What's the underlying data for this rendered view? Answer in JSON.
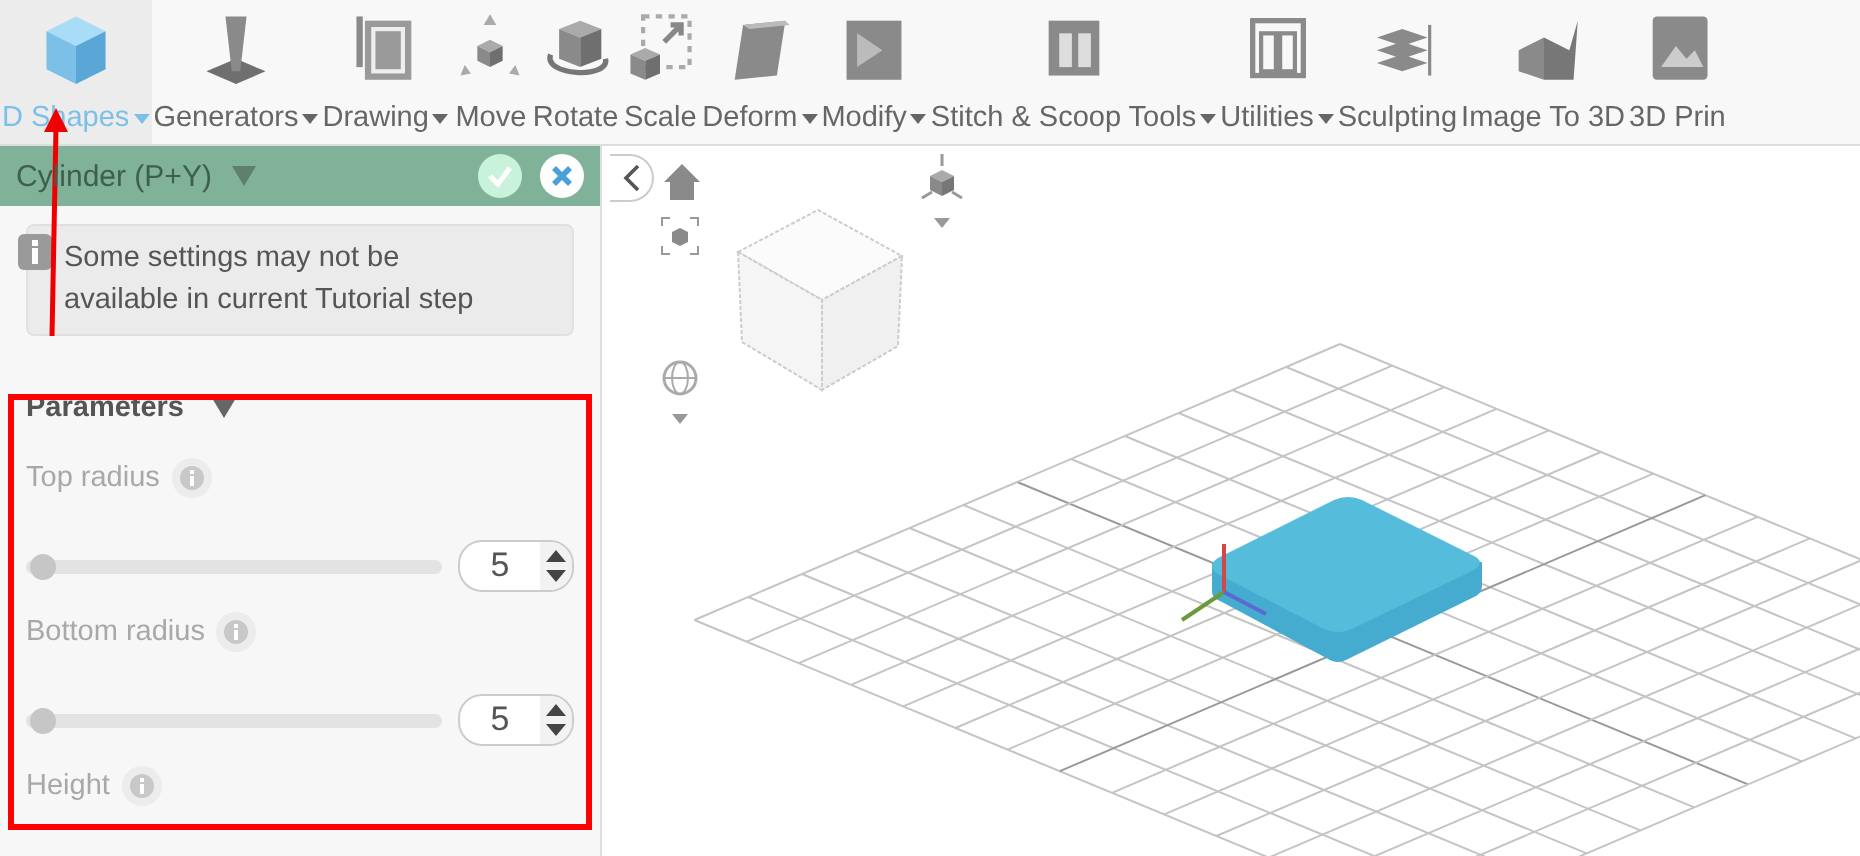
{
  "toolbar": {
    "items": [
      {
        "label": "D Shapes",
        "menu": true,
        "selected": true
      },
      {
        "label": "Generators",
        "menu": true,
        "selected": false
      },
      {
        "label": "Drawing",
        "menu": true,
        "selected": false
      },
      {
        "label": "Move",
        "menu": false,
        "selected": false
      },
      {
        "label": "Rotate",
        "menu": false,
        "selected": false
      },
      {
        "label": "Scale",
        "menu": false,
        "selected": false
      },
      {
        "label": "Deform",
        "menu": true,
        "selected": false
      },
      {
        "label": "Modify",
        "menu": true,
        "selected": false
      },
      {
        "label": "Stitch & Scoop Tools",
        "menu": true,
        "selected": false
      },
      {
        "label": "Utilities",
        "menu": true,
        "selected": false
      },
      {
        "label": "Sculpting",
        "menu": false,
        "selected": false
      },
      {
        "label": "Image To 3D",
        "menu": false,
        "selected": false
      },
      {
        "label": "3D Prin",
        "menu": false,
        "selected": false
      }
    ]
  },
  "panel": {
    "title": "Cylinder (P+Y)",
    "notice": "Some settings may not be available in current Tutorial step",
    "section": {
      "title": "Parameters",
      "expanded": true,
      "params": [
        {
          "label": "Top radius",
          "disabled": true,
          "level": 0.02,
          "value": "5"
        },
        {
          "label": "Bottom radius",
          "disabled": true,
          "level": 0.02,
          "value": "5"
        },
        {
          "label": "Height",
          "disabled": true
        }
      ]
    }
  }
}
